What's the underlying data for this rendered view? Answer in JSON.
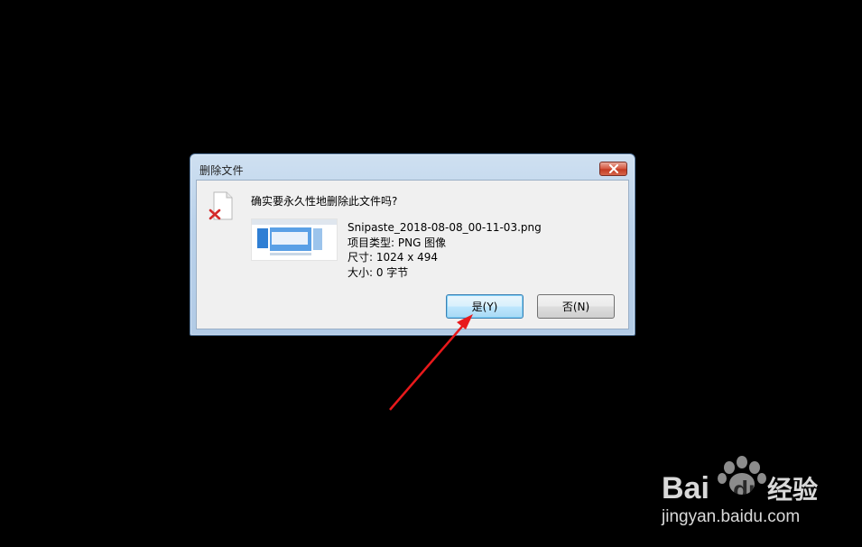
{
  "dialog": {
    "title": "删除文件",
    "question": "确实要永久性地删除此文件吗?",
    "file": {
      "name": "Snipaste_2018-08-08_00-11-03.png",
      "type_line": "项目类型: PNG 图像",
      "size_line": "尺寸: 1024 x 494",
      "bytes_line": "大小: 0 字节"
    },
    "buttons": {
      "yes_label": "是(Y)",
      "no_label": "否(N)"
    },
    "icons": {
      "close": "close-icon",
      "file": "deleted-file-icon"
    }
  },
  "annotation": {
    "arrow_color": "#e8191b"
  },
  "watermark": {
    "brand": "Bai",
    "brand_suffix": "经验",
    "url": "jingyan.baidu.com"
  }
}
